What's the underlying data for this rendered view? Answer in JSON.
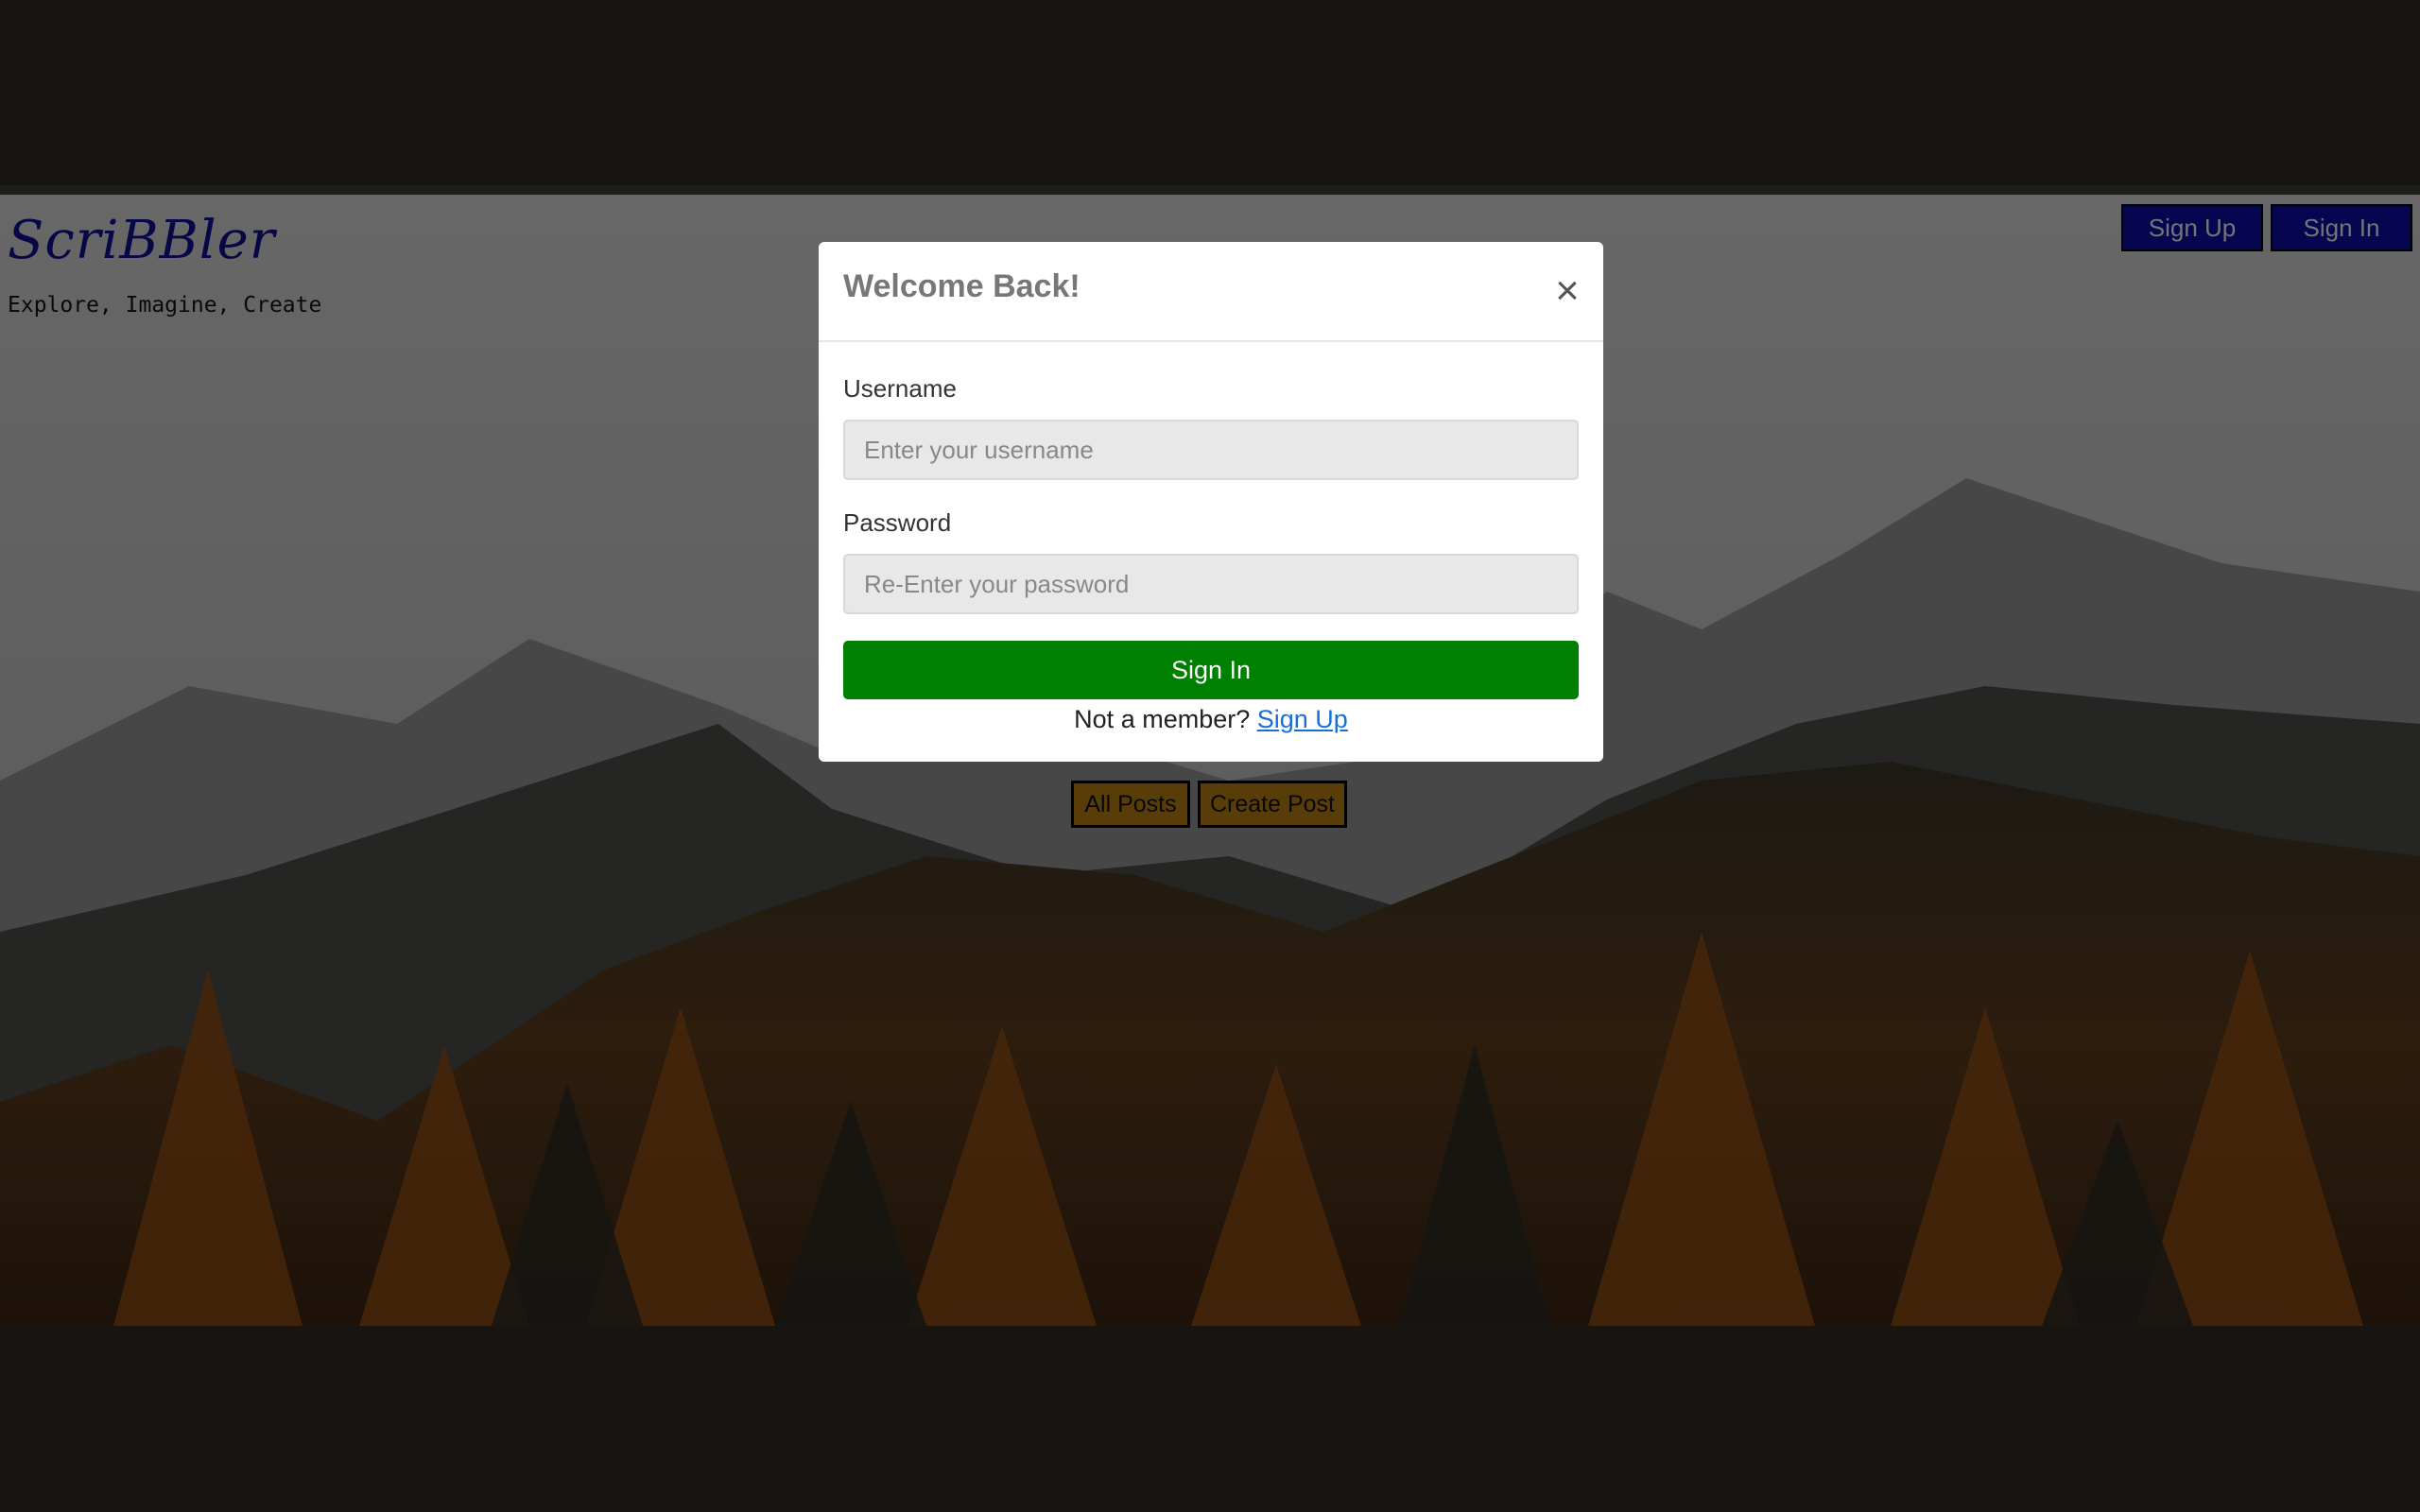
{
  "header": {
    "brand": "ScriBBler",
    "tagline": "Explore, Imagine, Create",
    "signup_label": "Sign Up",
    "signin_label": "Sign In"
  },
  "nav": {
    "all_posts_label": "All Posts",
    "create_post_label": "Create Post"
  },
  "modal": {
    "title": "Welcome Back!",
    "close_symbol": "×",
    "username_label": "Username",
    "username_placeholder": "Enter your username",
    "password_label": "Password",
    "password_placeholder": "Re-Enter your password",
    "submit_label": "Sign In",
    "member_prompt": "Not a member?",
    "member_link": "Sign Up"
  },
  "colors": {
    "page_bg": "#2d2a25",
    "header_button_bg": "#0a0aa0",
    "nav_button_bg": "#b07a10",
    "submit_bg": "#008000",
    "link": "#1a6fd6"
  },
  "icons": {
    "close": "close-icon"
  }
}
